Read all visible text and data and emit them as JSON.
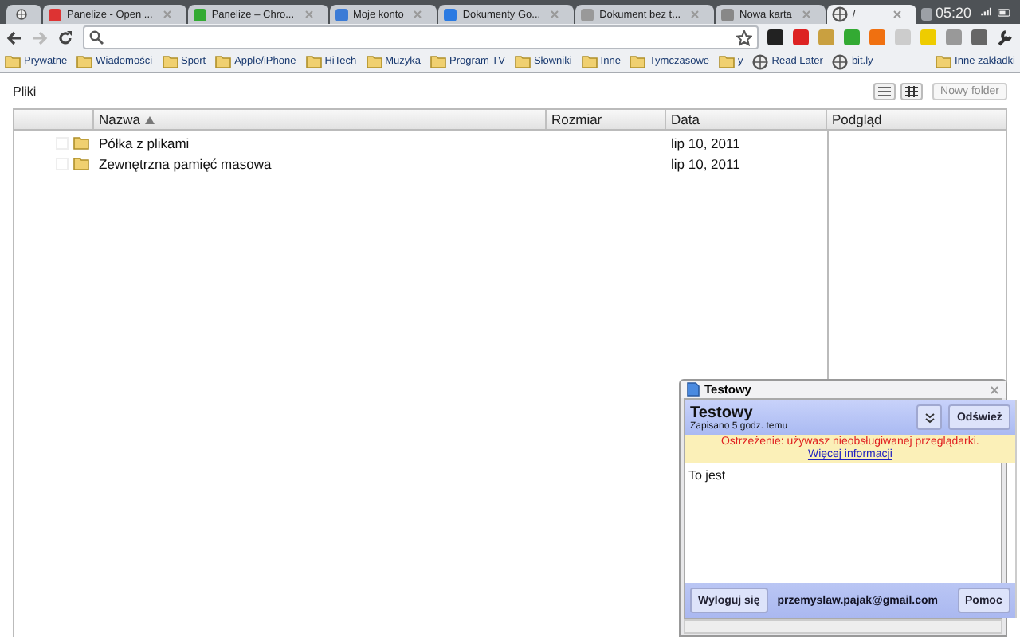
{
  "browser": {
    "tabs": [
      {
        "kind": "pinned",
        "selected": false
      },
      {
        "title": "Panelize - Open ...",
        "kind": "page",
        "selected": false
      },
      {
        "title": "Panelize – Chro...",
        "kind": "page",
        "selected": false
      },
      {
        "title": "Moje konto",
        "kind": "page",
        "selected": false
      },
      {
        "title": "Dokumenty Go...",
        "kind": "page",
        "selected": false
      },
      {
        "title": "Dokument bez t...",
        "kind": "page",
        "selected": false
      },
      {
        "title": "Nowa karta",
        "kind": "page",
        "selected": false
      },
      {
        "title": "/",
        "kind": "page",
        "selected": true
      }
    ],
    "clock": "05:20",
    "bookmarks": [
      {
        "label": "Prywatne",
        "kind": "folder"
      },
      {
        "label": "Wiadomości",
        "kind": "folder"
      },
      {
        "label": "Sport",
        "kind": "folder"
      },
      {
        "label": "Apple/iPhone",
        "kind": "folder"
      },
      {
        "label": "HiTech",
        "kind": "folder"
      },
      {
        "label": "Muzyka",
        "kind": "folder"
      },
      {
        "label": "Program TV",
        "kind": "folder"
      },
      {
        "label": "Słowniki",
        "kind": "folder"
      },
      {
        "label": "Inne",
        "kind": "folder"
      },
      {
        "label": "Tymczasowe",
        "kind": "folder"
      },
      {
        "label": "y",
        "kind": "folder"
      },
      {
        "label": "Read Later",
        "kind": "globe"
      },
      {
        "label": "bit.ly",
        "kind": "globe"
      }
    ],
    "other_bookmarks": "Inne zakładki"
  },
  "files": {
    "title": "Pliki",
    "new_folder": "Nowy folder",
    "columns": [
      {
        "label": "Nazwa",
        "sorted": true
      },
      {
        "label": "Rozmiar",
        "sorted": false
      },
      {
        "label": "Data",
        "sorted": false
      }
    ],
    "preview_label": "Podgląd",
    "rows": [
      {
        "name": "Półka z plikami",
        "checked": false,
        "date": "lip 10, 2011"
      },
      {
        "name": "Zewnętrzna pamięć masowa",
        "checked": false,
        "date": "lip 10, 2011"
      }
    ]
  },
  "popup": {
    "title": "Testowy",
    "doc_title": "Testowy",
    "saved": "Zapisano 5 godz. temu",
    "refresh": "Odśwież",
    "warning": "Ostrzeżenie: używasz nieobsługiwanej przeglądarki.",
    "warning_link": "Więcej informacji",
    "text": "To jest",
    "logout": "Wyloguj się",
    "email": "przemyslaw.pajak@gmail.com",
    "help": "Pomoc"
  }
}
